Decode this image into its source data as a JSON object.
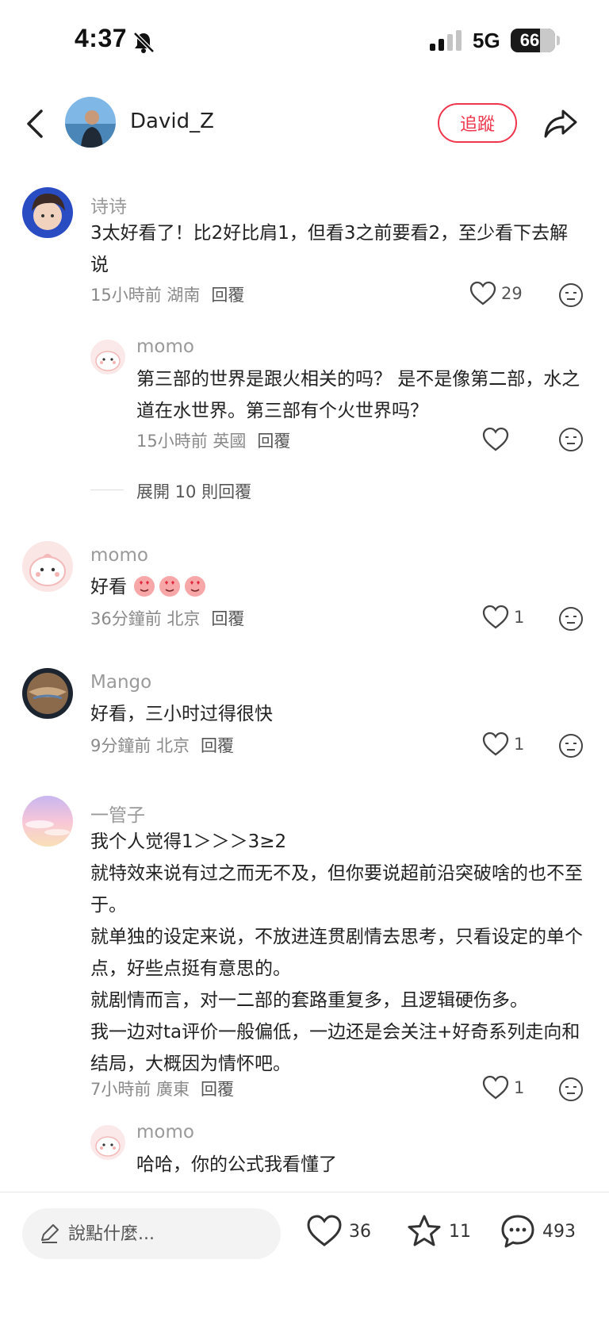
{
  "status_bar": {
    "time": "4:37",
    "network": "5G",
    "battery": "66"
  },
  "header": {
    "username": "David_Z",
    "follow_label": "追蹤"
  },
  "comments": [
    {
      "name": "诗诗",
      "text": "3太好看了！比2好比肩1，但看3之前要看2，至少看下去解说",
      "meta": "15小時前 湖南",
      "reply_label": "回覆",
      "likes": "29",
      "replies": [
        {
          "name": "momo",
          "text": "第三部的世界是跟火相关的吗？ 是不是像第二部，水之道在水世界。第三部有个火世界吗？",
          "meta": "15小時前 英國",
          "reply_label": "回覆",
          "likes": ""
        }
      ],
      "expand_label": "展開 10 則回覆"
    },
    {
      "name": "momo",
      "text": "好看",
      "meta": "36分鐘前 北京",
      "reply_label": "回覆",
      "likes": "1"
    },
    {
      "name": "Mango",
      "text": "好看，三小时过得很快",
      "meta": "9分鐘前 北京",
      "reply_label": "回覆",
      "likes": "1"
    },
    {
      "name": "一管子",
      "text_lines": [
        "我个人觉得1＞＞＞3≥2",
        "就特效来说有过之而无不及，但你要说超前沿突破啥的也不至于。",
        "就单独的设定来说，不放进连贯剧情去思考，只看设定的单个点，好些点挺有意思的。",
        "就剧情而言，对一二部的套路重复多，且逻辑硬伤多。",
        "我一边对ta评价一般偏低，一边还是会关注+好奇系列走向和结局，大概因为情怀吧。"
      ],
      "meta": "7小時前 廣東",
      "reply_label": "回覆",
      "likes": "1",
      "replies": [
        {
          "name": "momo",
          "text": "哈哈，你的公式我看懂了"
        }
      ]
    }
  ],
  "bottom_bar": {
    "input_placeholder": "說點什麼...",
    "likes": "36",
    "favorites": "11",
    "comments": "493"
  },
  "colors": {
    "accent": "#f0364c",
    "meta_gray": "#8a8a8a"
  }
}
